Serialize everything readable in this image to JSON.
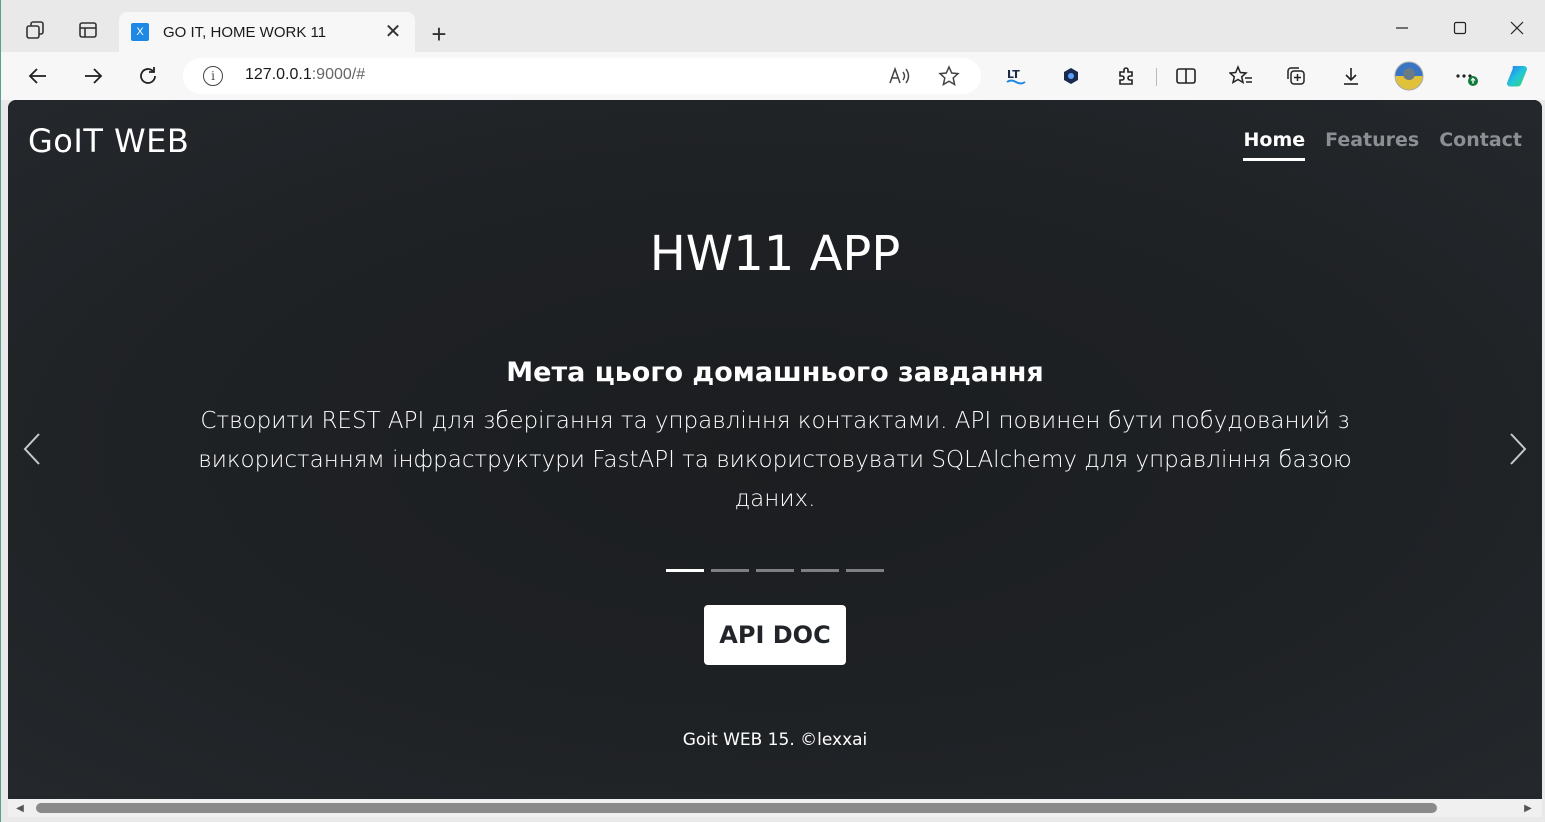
{
  "browser": {
    "tab": {
      "favicon_letter": "X",
      "title": "GO IT, HOME WORK 11",
      "close": "✕"
    },
    "new_tab": "+",
    "window_controls": {
      "minimize": "—",
      "maximize": "☐",
      "close": "✕"
    },
    "address": {
      "host": "127.0.0.1",
      "rest": ":9000/#"
    },
    "icons": [
      "workspaces-icon",
      "tab-actions-icon",
      "back-icon",
      "forward-icon",
      "refresh-icon",
      "info-icon",
      "read-aloud-icon",
      "favorite-star-icon",
      "extension-lt-icon",
      "extension-hex-icon",
      "extensions-icon",
      "split-screen-icon",
      "favorites-icon",
      "collections-icon",
      "downloads-icon",
      "profile-avatar",
      "more-icon",
      "copilot-icon"
    ]
  },
  "page": {
    "brand": "GoIT WEB",
    "nav": [
      {
        "label": "Home",
        "active": true
      },
      {
        "label": "Features",
        "active": false
      },
      {
        "label": "Contact",
        "active": false
      }
    ],
    "hero_title": "HW11 APP",
    "slide": {
      "heading": "Мета цього домашнього завдання",
      "text": "Створити REST API для зберігання та управління контактами. API повинен бути побудований з використанням інфраструктури FastAPI та використовувати SQLAlchemy для управління базою даних."
    },
    "indicators": {
      "count": 5,
      "active_index": 0
    },
    "api_button": "API DOC",
    "footer": "Goit WEB 15. ©lexxai"
  },
  "colors": {
    "page_bg": "#212529",
    "nav_inactive": "#8c8f93",
    "browser_chrome": "#e9e9e9",
    "tab_favicon": "#1e88e5"
  }
}
